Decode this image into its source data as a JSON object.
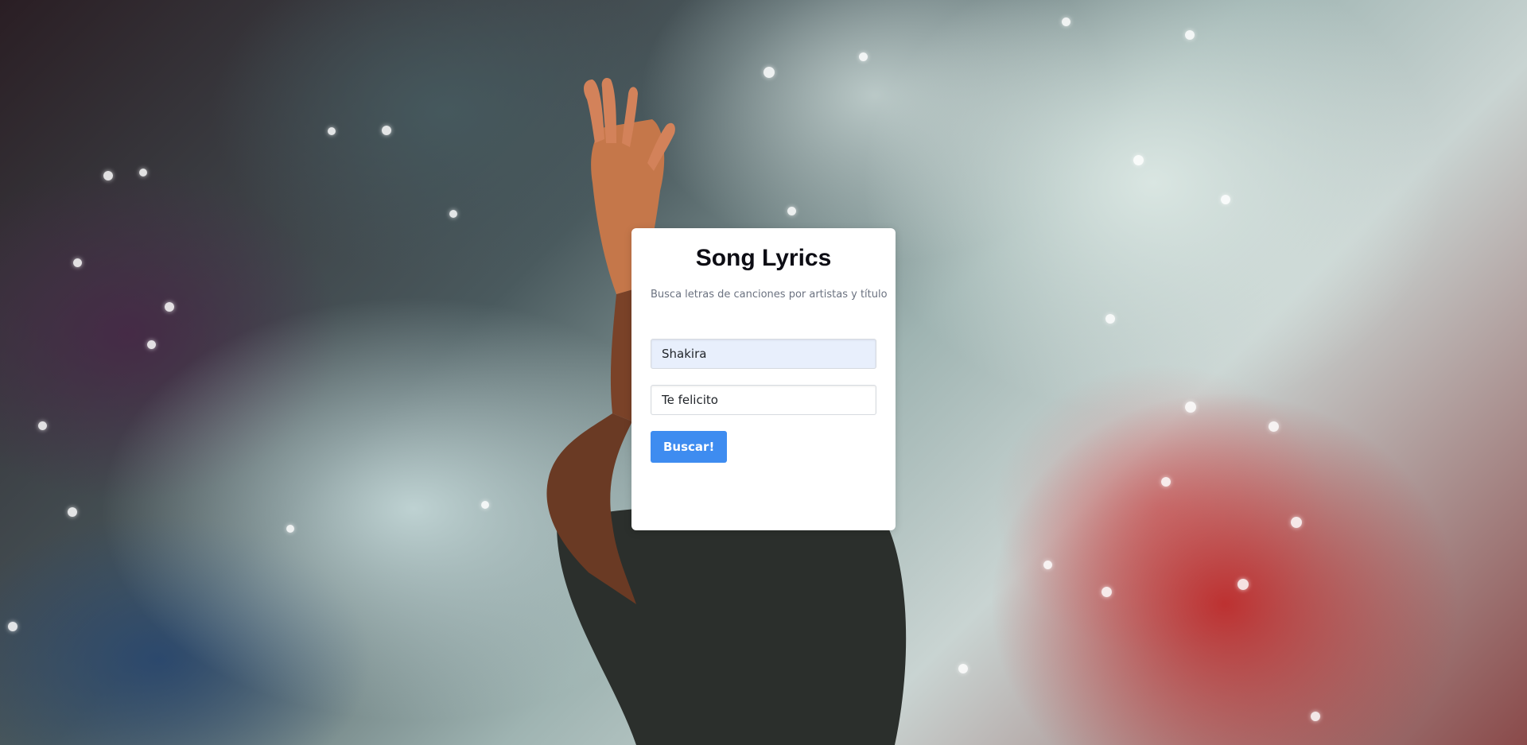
{
  "app": {
    "title": "Song Lyrics",
    "subtitle": "Busca letras de canciones por artistas y título"
  },
  "form": {
    "artist_value": "Shakira",
    "song_value": "Te felicito",
    "submit_label": "Buscar!"
  },
  "colors": {
    "accent": "#3e8cf0",
    "card_bg": "#ffffff",
    "autofill_bg": "#e8effc"
  }
}
